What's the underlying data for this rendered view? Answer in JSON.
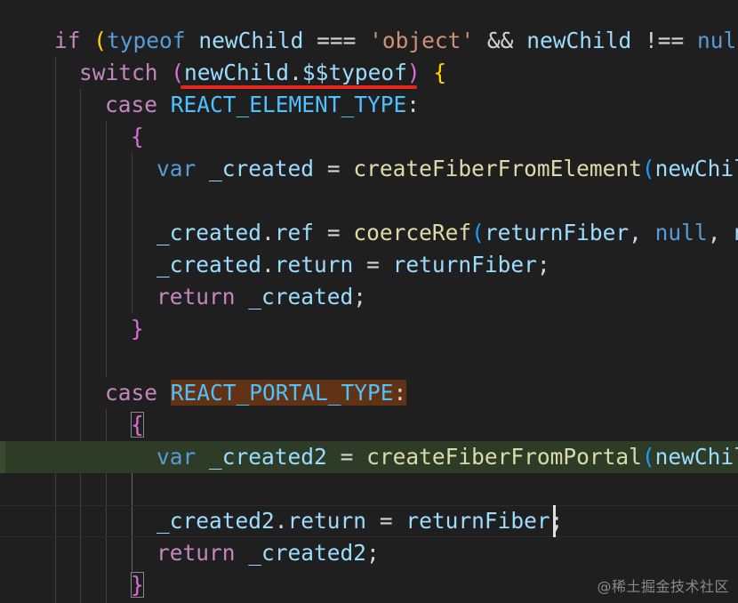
{
  "editor": {
    "theme_colors": {
      "background": "#1f1f1f",
      "keyword": "#569cd6",
      "control_flow": "#c586c0",
      "variable": "#9cdcfe",
      "string": "#ce9178",
      "function": "#dcdcaa",
      "constant": "#4fc1ff",
      "current_line_highlight": "#2d3b27",
      "selection_highlight": "#613214",
      "annotation_underline": "#e8271e"
    },
    "lines": {
      "l1": {
        "if": "if",
        "open_paren": "(",
        "typeof": "typeof",
        "var1": "newChild",
        "op1": "===",
        "str": "'object'",
        "op2": "&&",
        "var2": "newChild",
        "op3": "!==",
        "null": "null"
      },
      "l2": {
        "switch": "switch",
        "open_paren": "(",
        "expr_obj": "newChild",
        "dot": ".",
        "expr_prop": "$$typeof",
        "close_paren": ")",
        "open_brace": "{"
      },
      "l3": {
        "case": "case",
        "const": "REACT_ELEMENT_TYPE",
        "colon": ":"
      },
      "l4": {
        "open_brace": "{"
      },
      "l5": {
        "var": "var",
        "name": "_created",
        "eq": "=",
        "fn": "createFiberFromElement",
        "open_paren": "(",
        "arg": "newChilc"
      },
      "l7": {
        "obj": "_created",
        "dot": ".",
        "prop": "ref",
        "eq": "=",
        "fn": "coerceRef",
        "open_paren": "(",
        "arg1": "returnFiber",
        "comma1": ",",
        "null": "null",
        "comma2": ",",
        "arg3": "ne"
      },
      "l8": {
        "obj": "_created",
        "dot": ".",
        "prop": "return",
        "eq": "=",
        "val": "returnFiber",
        "semi": ";"
      },
      "l9": {
        "return": "return",
        "val": "_created",
        "semi": ";"
      },
      "l10": {
        "close_brace": "}"
      },
      "l12": {
        "case": "case",
        "const": "REACT_PORTAL_TYPE",
        "colon": ":"
      },
      "l13": {
        "open_brace": "{"
      },
      "l14": {
        "var": "var",
        "name": "_created2",
        "eq": "=",
        "fn": "createFiberFromPortal",
        "open_paren": "(",
        "arg": "newChilc"
      },
      "l16": {
        "obj": "_created2",
        "dot": ".",
        "prop": "return",
        "eq": "=",
        "val": "returnFiber",
        "semi": ";"
      },
      "l17": {
        "return": "return",
        "val": "_created2",
        "semi": ";"
      },
      "l18": {
        "close_brace": "}"
      }
    }
  },
  "watermark": {
    "text": "@稀土掘金技术社区"
  }
}
